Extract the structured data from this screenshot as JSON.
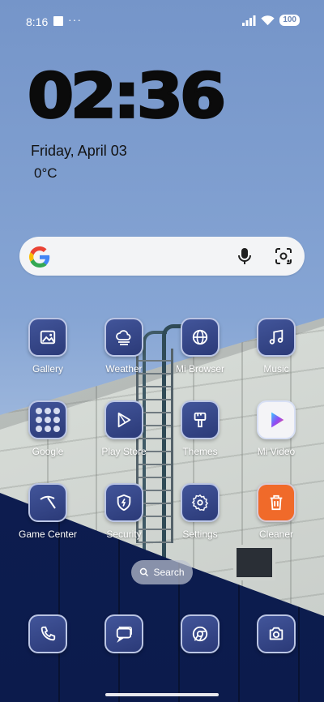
{
  "status_bar": {
    "time": "8:16",
    "dots": "···",
    "battery": "100"
  },
  "clock_widget": {
    "time": "02:36",
    "date": "Friday, April 03",
    "temperature": "0°C"
  },
  "search_widget": {
    "icons": [
      "google-logo",
      "mic-icon",
      "lens-icon"
    ]
  },
  "apps": {
    "gallery": {
      "label": "Gallery",
      "icon": "gallery-icon"
    },
    "weather": {
      "label": "Weather",
      "icon": "weather-icon"
    },
    "mi_browser": {
      "label": "Mi Browser",
      "icon": "globe-icon"
    },
    "music": {
      "label": "Music",
      "icon": "music-icon"
    },
    "google": {
      "label": "Google",
      "icon": "google-folder-icon"
    },
    "play_store": {
      "label": "Play Store",
      "icon": "play-store-icon"
    },
    "themes": {
      "label": "Themes",
      "icon": "brush-icon"
    },
    "mi_video": {
      "label": "Mi Video",
      "icon": "mi-video-icon"
    },
    "game_center": {
      "label": "Game Center",
      "icon": "game-center-icon"
    },
    "security": {
      "label": "Security",
      "icon": "shield-icon"
    },
    "settings": {
      "label": "Settings",
      "icon": "gear-icon"
    },
    "cleaner": {
      "label": "Cleaner",
      "icon": "trash-icon"
    }
  },
  "search_pill": {
    "label": "Search"
  },
  "dock": [
    {
      "name": "Phone",
      "icon": "phone-icon"
    },
    {
      "name": "Messages",
      "icon": "messages-icon"
    },
    {
      "name": "Chrome",
      "icon": "chrome-icon"
    },
    {
      "name": "Camera",
      "icon": "camera-icon"
    }
  ],
  "colors": {
    "sky": "#7c9ccb",
    "navy": "#0f2057",
    "icon_bg": "#33447f",
    "cleaner_orange": "#f06a2a"
  }
}
